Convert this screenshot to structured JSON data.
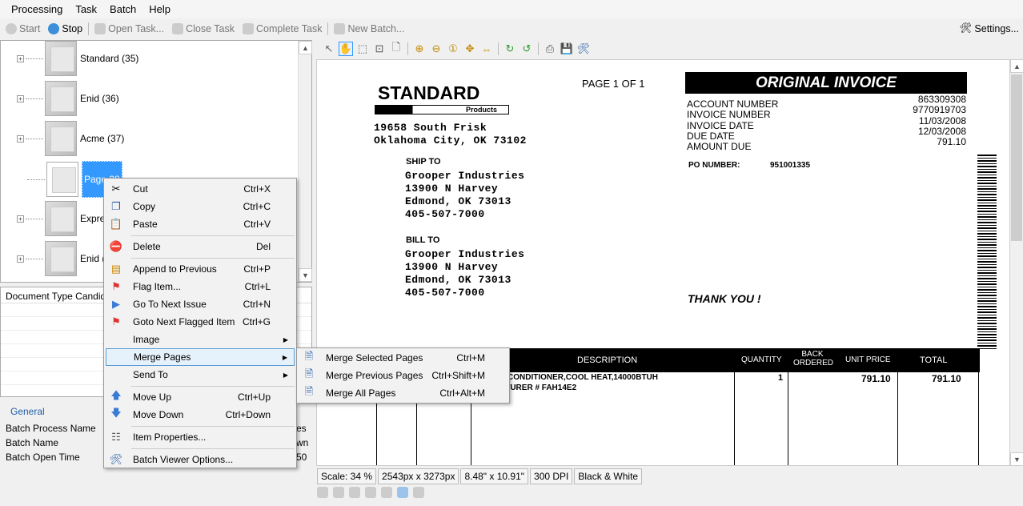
{
  "menu": [
    "Processing",
    "Task",
    "Batch",
    "Help"
  ],
  "toolbar": {
    "start": "Start",
    "stop": "Stop",
    "open_task": "Open Task...",
    "close_task": "Close Task",
    "complete_task": "Complete Task",
    "new_batch": "New Batch...",
    "settings": "Settings..."
  },
  "tree": [
    "Standard (35)",
    "Enid (36)",
    "Acme (37)",
    "Page 38",
    "Expre",
    "Enid ("
  ],
  "doctypes": {
    "header": "Document Type Candidates"
  },
  "general": {
    "title": "General",
    "rows": [
      "Batch Process Name",
      "Batch Name",
      "Batch Open Time"
    ],
    "values": [
      "es",
      "wn",
      "50"
    ]
  },
  "context_menu": [
    {
      "label": "Cut",
      "key": "Ctrl+X",
      "icon": "scissors-icon"
    },
    {
      "label": "Copy",
      "key": "Ctrl+C",
      "icon": "copy-icon"
    },
    {
      "label": "Paste",
      "key": "Ctrl+V",
      "icon": "paste-icon"
    },
    {
      "label": "Delete",
      "key": "Del",
      "icon": "delete-icon"
    },
    {
      "label": "Append to Previous",
      "key": "Ctrl+P",
      "icon": "append-icon"
    },
    {
      "label": "Flag Item...",
      "key": "Ctrl+L",
      "icon": "flag-icon"
    },
    {
      "label": "Go To Next Issue",
      "key": "Ctrl+N",
      "icon": "next-icon"
    },
    {
      "label": "Goto Next Flagged Item",
      "key": "Ctrl+G",
      "icon": "flag-next-icon"
    },
    {
      "label": "Image",
      "key": "",
      "icon": ""
    },
    {
      "label": "Merge Pages",
      "key": "",
      "icon": ""
    },
    {
      "label": "Send To",
      "key": "",
      "icon": ""
    },
    {
      "label": "Move Up",
      "key": "Ctrl+Up",
      "icon": "arrow-up-icon"
    },
    {
      "label": "Move Down",
      "key": "Ctrl+Down",
      "icon": "arrow-down-icon"
    },
    {
      "label": "Item Properties...",
      "key": "",
      "icon": "properties-icon"
    },
    {
      "label": "Batch Viewer Options...",
      "key": "",
      "icon": "tools-icon"
    }
  ],
  "submenu": [
    {
      "label": "Merge Selected Pages",
      "key": "Ctrl+M"
    },
    {
      "label": "Merge Previous Pages",
      "key": "Ctrl+Shift+M"
    },
    {
      "label": "Merge All Pages",
      "key": "Ctrl+Alt+M"
    }
  ],
  "invoice": {
    "logo": "STANDARD",
    "logo_sub": "Products",
    "page": "PAGE 1 OF 1",
    "title": "ORIGINAL INVOICE",
    "address": [
      "19658 South Frisk",
      "Oklahoma City, OK 73102"
    ],
    "fields": [
      "ACCOUNT NUMBER",
      "INVOICE NUMBER",
      "INVOICE DATE",
      "DUE DATE",
      "AMOUNT DUE"
    ],
    "field_values": [
      "863309308",
      "9770919703",
      "11/03/2008",
      "12/03/2008",
      "791.10"
    ],
    "po_label": "PO NUMBER:",
    "po_value": "951001335",
    "ship_to_label": "SHIP TO",
    "ship_to": [
      "Grooper Industries",
      "13900 N Harvey",
      "Edmond, OK 73013",
      "405-507-7000"
    ],
    "bill_to_label": "BILL TO",
    "bill_to": [
      "Grooper Industries",
      "13900 N Harvey",
      "Edmond, OK 73013",
      "405-507-7000"
    ],
    "thanks": "THANK YOU !",
    "columns": [
      "DESCRIPTION",
      "QUANTITY",
      "BACK ORDERED",
      "UNIT PRICE",
      "TOTAL"
    ],
    "line": [
      "R CONDITIONER,COOL HEAT,14000BTUH",
      "CTURER # FAH14E2",
      "1",
      "791.10",
      "791.10"
    ]
  },
  "status": [
    "Scale: 34 %",
    "2543px x 3273px",
    "8.48\" x 10.91\"",
    "300 DPI",
    "Black & White"
  ]
}
